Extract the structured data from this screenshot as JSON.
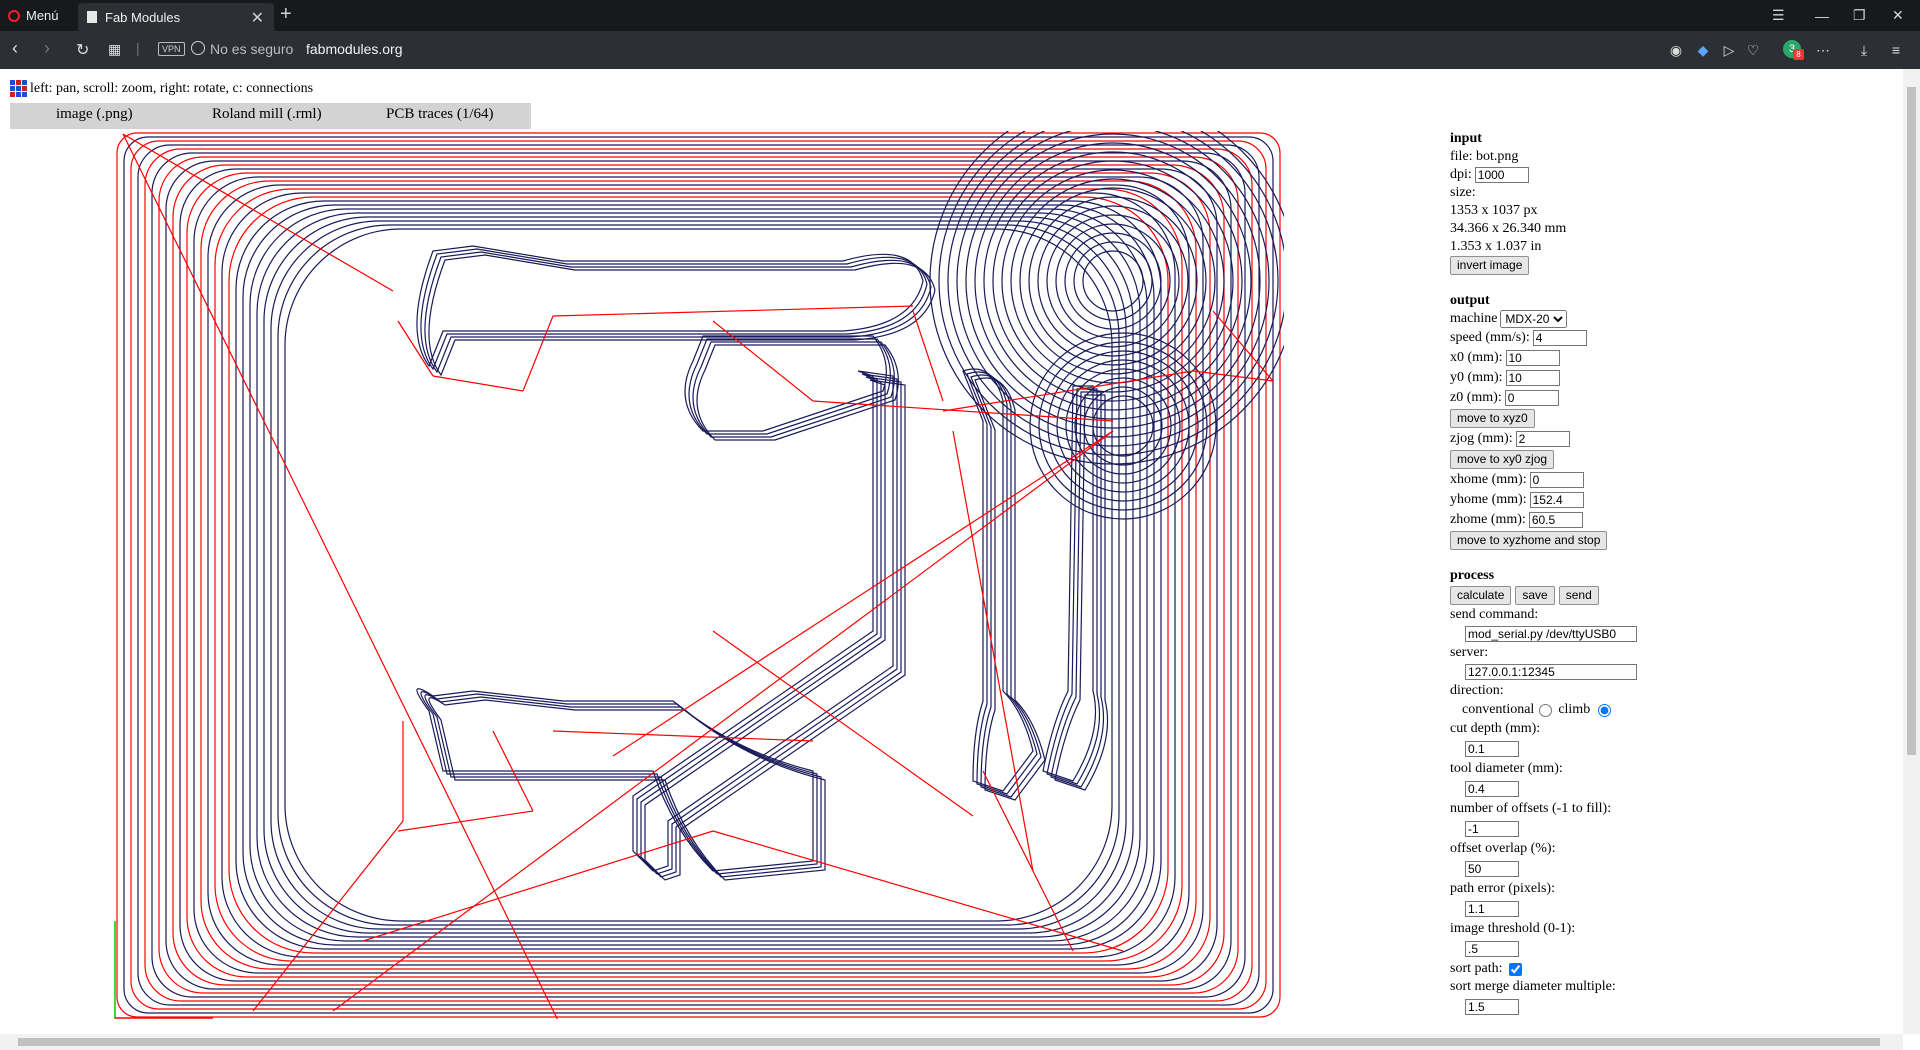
{
  "browser": {
    "menu_label": "Menú",
    "tab_title": "Fab Modules",
    "vpn_label": "VPN",
    "security_label": "No es seguro",
    "url": "fabmodules.org"
  },
  "page": {
    "instructions": "left: pan, scroll: zoom, right: rotate, c: connections",
    "breadcrumbs": [
      "image (.png)",
      "Roland mill (.rml)",
      "PCB traces (1/64)"
    ]
  },
  "colors": {
    "trace": "#1a1a5a",
    "move": "#ff0000",
    "axis": "#00cc00"
  },
  "input": {
    "heading": "input",
    "file": "file: bot.png",
    "dpi_label": "dpi:",
    "dpi": "1000",
    "size_label": "size:",
    "size_px": "1353 x 1037 px",
    "size_mm": "34.366 x 26.340 mm",
    "size_in": "1.353 x 1.037 in",
    "invert_button": "invert image"
  },
  "output": {
    "heading": "output",
    "machine_label": "machine",
    "machine": "MDX-20",
    "speed_label": "speed (mm/s):",
    "speed": "4",
    "x0_label": "x0 (mm):",
    "x0": "10",
    "y0_label": "y0 (mm):",
    "y0": "10",
    "z0_label": "z0 (mm):",
    "z0": "0",
    "move_xyz0_button": "move to xyz0",
    "zjog_label": "zjog (mm):",
    "zjog": "2",
    "move_zjog_button": "move to xy0 zjog",
    "xhome_label": "xhome (mm):",
    "xhome": "0",
    "yhome_label": "yhome (mm):",
    "yhome": "152.4",
    "zhome_label": "zhome (mm):",
    "zhome": "60.5",
    "move_home_button": "move to xyzhome and stop"
  },
  "process": {
    "heading": "process",
    "calculate_button": "calculate",
    "save_button": "save",
    "send_button": "send",
    "send_command_label": "send command:",
    "send_command": "mod_serial.py /dev/ttyUSB0",
    "server_label": "server:",
    "server": "127.0.0.1:12345",
    "direction_label": "direction:",
    "conventional_label": "conventional",
    "climb_label": "climb",
    "cut_depth_label": "cut depth (mm):",
    "cut_depth": "0.1",
    "tool_diameter_label": "tool diameter (mm):",
    "tool_diameter": "0.4",
    "offsets_label": "number of offsets (-1 to fill):",
    "offsets": "-1",
    "overlap_label": "offset overlap (%):",
    "overlap": "50",
    "path_error_label": "path error (pixels):",
    "path_error": "1.1",
    "threshold_label": "image threshold (0-1):",
    "threshold": ".5",
    "sort_path_label": "sort path:",
    "sort_merge_label": "sort merge diameter multiple:",
    "sort_merge": "1.5"
  }
}
